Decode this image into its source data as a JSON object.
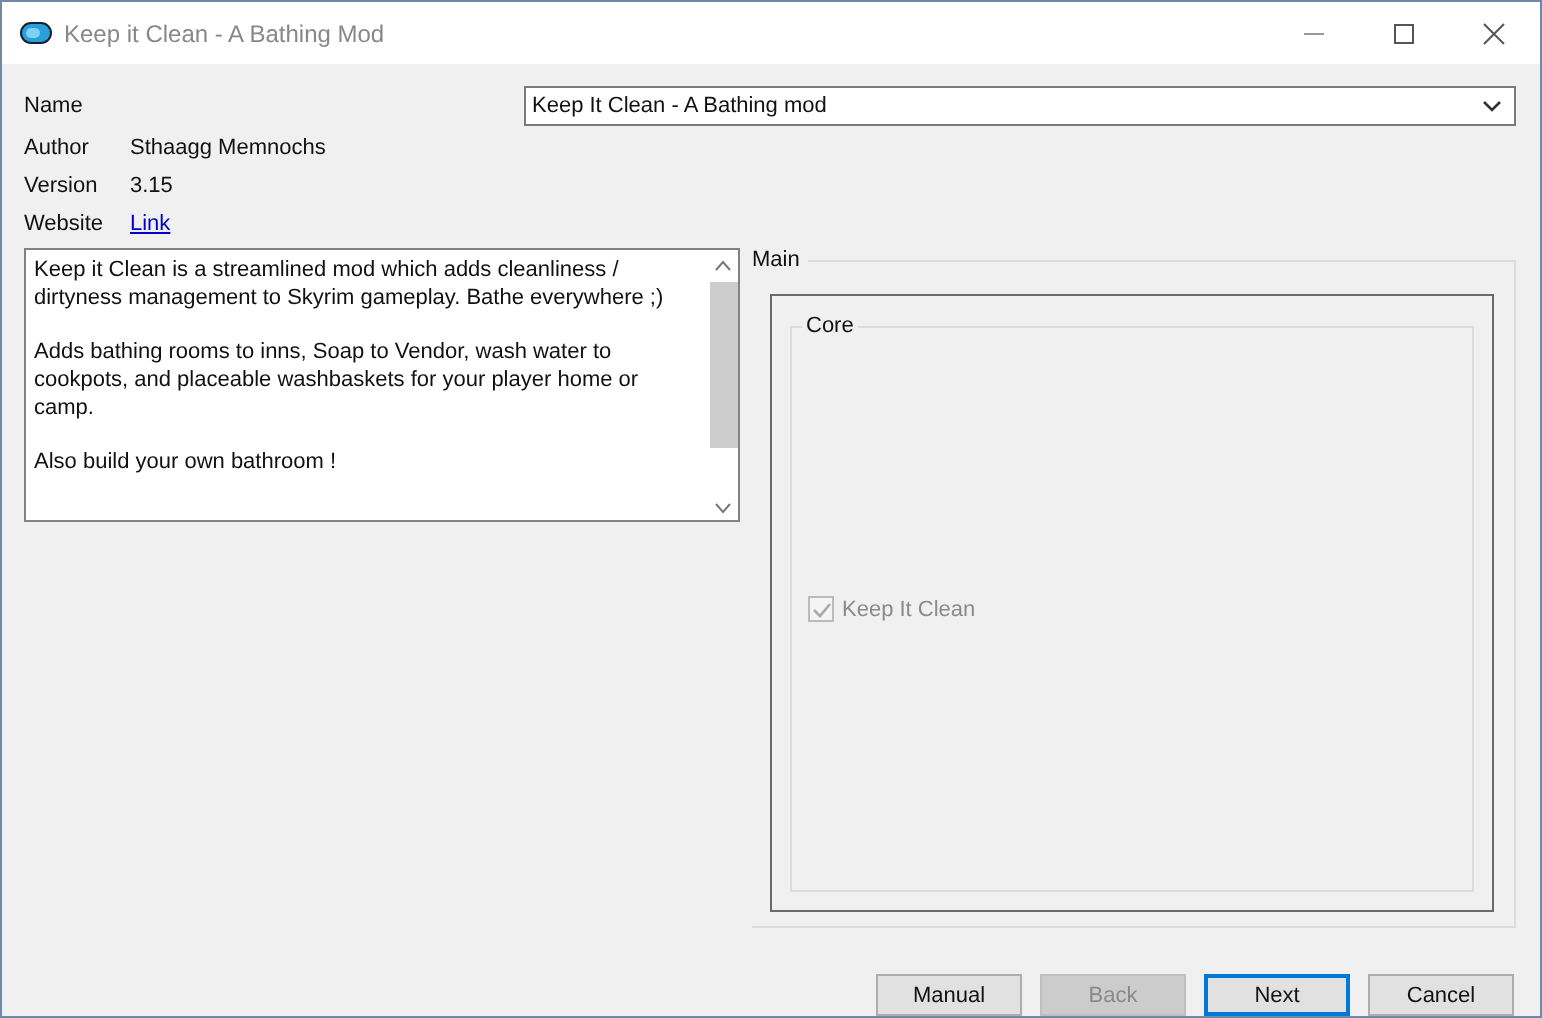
{
  "window": {
    "title": "Keep it Clean - A Bathing Mod"
  },
  "fields": [
    {
      "label": "Name",
      "kind": "dropdown",
      "value": "Keep It Clean - A Bathing mod"
    },
    {
      "label": "Author",
      "kind": "text",
      "value": "Sthaagg Memnochs"
    },
    {
      "label": "Version",
      "kind": "text",
      "value": "3.15"
    },
    {
      "label": "Website",
      "kind": "link",
      "value": "Link"
    }
  ],
  "description": [
    "Keep it Clean is a streamlined mod which adds cleanliness / dirtyness management to Skyrim gameplay. Bathe everywhere ;)",
    "Adds bathing rooms to inns, Soap to Vendor, wash water to cookpots, and placeable washbaskets for your player home or camp.",
    "Also build your own bathroom !"
  ],
  "step": {
    "title": "Main",
    "group": {
      "title": "Core",
      "options": [
        {
          "label": "Keep It Clean",
          "checked": true,
          "disabled": true
        }
      ]
    }
  },
  "buttons": [
    {
      "label": "Manual",
      "disabled": false,
      "default": false
    },
    {
      "label": "Back",
      "disabled": true,
      "default": false
    },
    {
      "label": "Next",
      "disabled": false,
      "default": true
    },
    {
      "label": "Cancel",
      "disabled": false,
      "default": false
    }
  ]
}
